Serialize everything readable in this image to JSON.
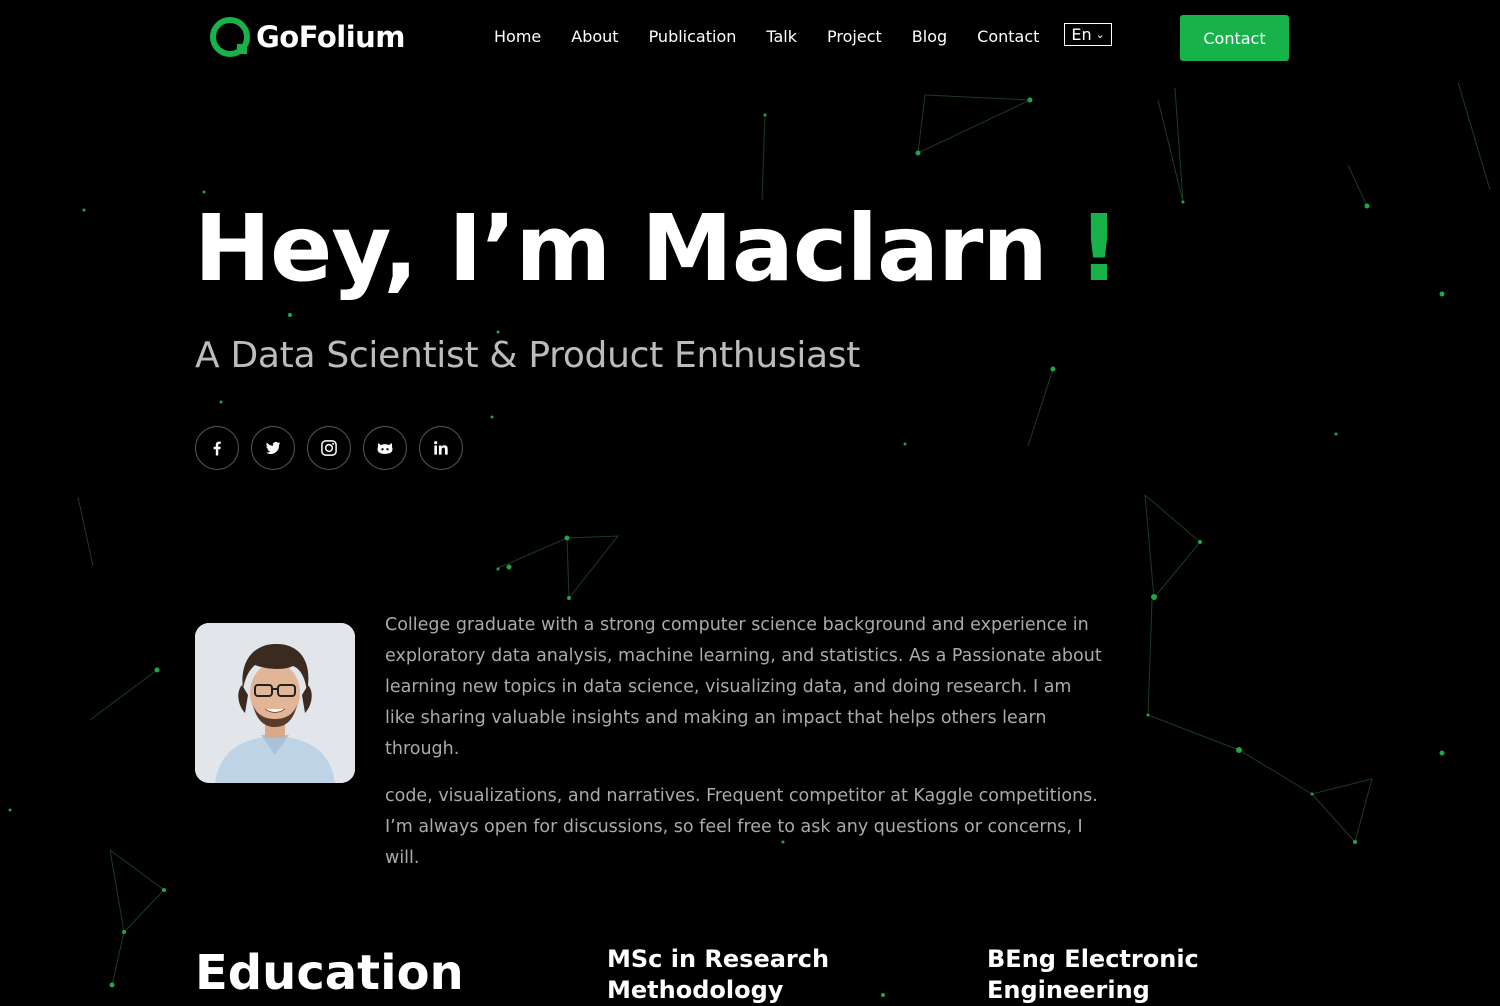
{
  "brand": {
    "name": "GoFolium",
    "accent": "#17b34a"
  },
  "nav": {
    "items": [
      "Home",
      "About",
      "Publication",
      "Talk",
      "Project",
      "Blog",
      "Contact"
    ],
    "language": "En"
  },
  "header": {
    "contact_label": "Contact"
  },
  "hero": {
    "title": "Hey, I’m Maclarn",
    "exclamation": "!",
    "subtitle": "A Data Scientist & Product Enthusiast"
  },
  "socials": [
    {
      "icon": "facebook-icon"
    },
    {
      "icon": "twitter-icon"
    },
    {
      "icon": "instagram-icon"
    },
    {
      "icon": "github-icon"
    },
    {
      "icon": "linkedin-icon"
    }
  ],
  "about": {
    "paragraph_1": "College graduate with a strong computer science background and experience in exploratory data analysis, machine learning, and statistics. As a Passionate about learning new topics in data science, visualizing data, and doing research. I am like sharing valuable insights and making an impact that helps others learn through.",
    "paragraph_2": "code, visualizations, and narratives. Frequent competitor at Kaggle competitions. I’m always open for discussions, so feel free to ask any questions or concerns, I will."
  },
  "education": {
    "title": "Education",
    "degrees": [
      "MSc in Research Methodology",
      "BEng Electronic Engineering"
    ]
  }
}
